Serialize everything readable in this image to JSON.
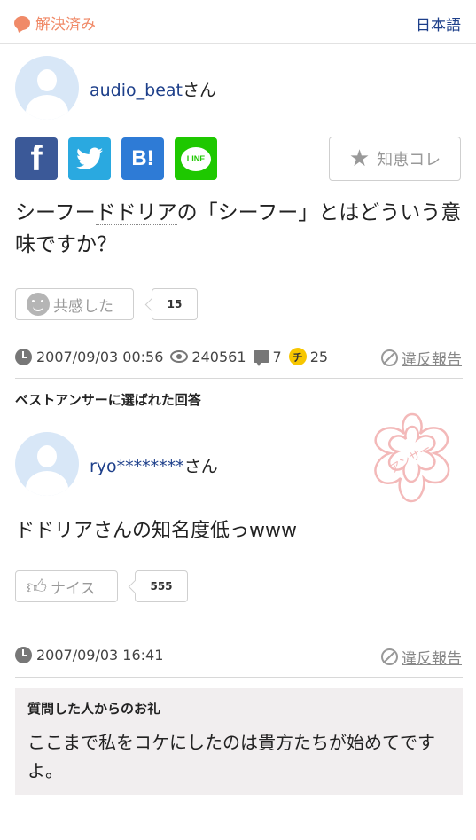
{
  "header": {
    "status_label": "解決済み",
    "language_label": "日本語"
  },
  "question": {
    "user_id": "audio_beat",
    "user_suffix": "さん",
    "share": {
      "facebook": "f",
      "hatena": "B!",
      "line": "LINE"
    },
    "chie_label": "知恵コレ",
    "text_pre": "シーフー",
    "text_link": "ドドリア",
    "text_post": "の「シーフー」とはどういう意味ですか？",
    "empathy_label": "共感した",
    "empathy_count": "15",
    "datetime": "2007/09/03 00:56",
    "views": "240561",
    "answers": "7",
    "coin_symbol": "チ",
    "coins": "25",
    "report_label": "違反報告"
  },
  "best_answer": {
    "heading": "ベストアンサーに選ばれた回答",
    "user_id": "ryo********",
    "user_suffix": "さん",
    "text": "ドドリアさんの知名度低っwww",
    "nice_label": "ナイス",
    "nice_count": "555",
    "datetime": "2007/09/03 16:41",
    "report_label": "違反報告",
    "stamp_text": "アンサー"
  },
  "thanks": {
    "title": "質問した人からのお礼",
    "body": "ここまで私をコケにしたのは貴方たちが始めてですよ。"
  },
  "colors": {
    "accent_orange": "#f08a68",
    "link_blue": "#1d3f8a",
    "facebook": "#3b5998",
    "twitter": "#2aa9e0",
    "hatena": "#2e7bd6",
    "line": "#1ec800",
    "coin": "#f7c600",
    "thanks_bg": "#f1eeef"
  }
}
